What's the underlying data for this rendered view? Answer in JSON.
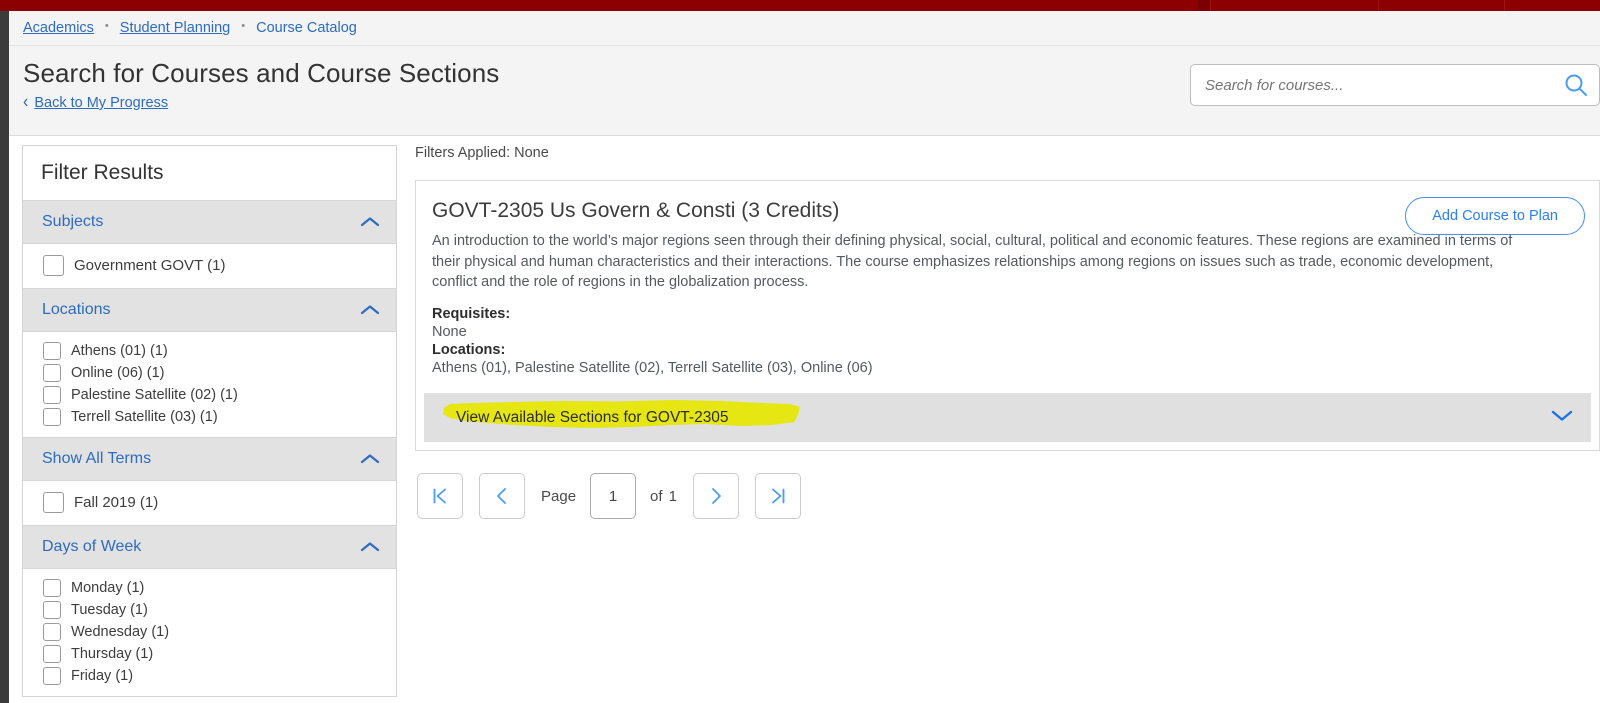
{
  "colors": {
    "brand_red": "#8b0000",
    "link_blue": "#2d6cc0",
    "accent_blue": "#2d7ff0",
    "icon_blue": "#4a9cf0",
    "highlight_yellow": "#e8e800",
    "section_gray": "#e0e0e0",
    "header_gray": "#e2e2e2"
  },
  "breadcrumb": {
    "items": [
      {
        "label": "Academics",
        "current": false
      },
      {
        "label": "Student Planning",
        "current": false
      },
      {
        "label": "Course Catalog",
        "current": true
      }
    ],
    "separator": "•"
  },
  "header": {
    "title": "Search for Courses and Course Sections",
    "back_link": "Back to My Progress",
    "back_chevron_icon": "chevron-left-icon"
  },
  "search": {
    "placeholder": "Search for courses...",
    "value": "",
    "icon": "search-icon"
  },
  "filters": {
    "title": "Filter Results",
    "collapse_icon": "chevron-up-icon",
    "sections": [
      {
        "label": "Subjects",
        "options": [
          {
            "label": "Government GOVT (1)",
            "checked": false
          }
        ]
      },
      {
        "label": "Locations",
        "options": [
          {
            "label": "Athens (01) (1)",
            "checked": false
          },
          {
            "label": "Online (06) (1)",
            "checked": false
          },
          {
            "label": "Palestine Satellite (02) (1)",
            "checked": false
          },
          {
            "label": "Terrell Satellite (03) (1)",
            "checked": false
          }
        ]
      },
      {
        "label": "Show All Terms",
        "options": [
          {
            "label": "Fall 2019 (1)",
            "checked": false
          }
        ]
      },
      {
        "label": "Days of Week",
        "options": [
          {
            "label": "Monday (1)",
            "checked": false
          },
          {
            "label": "Tuesday (1)",
            "checked": false
          },
          {
            "label": "Wednesday (1)",
            "checked": false
          },
          {
            "label": "Thursday (1)",
            "checked": false
          },
          {
            "label": "Friday (1)",
            "checked": false
          }
        ]
      }
    ]
  },
  "results": {
    "filters_applied_label": "Filters Applied:",
    "filters_applied_value": "None",
    "course": {
      "title": "GOVT-2305 Us Govern & Consti (3 Credits)",
      "add_button": "Add Course to Plan",
      "description": "An introduction to the world’s major regions seen through their defining physical, social, cultural, political and economic features. These regions are examined in terms of their physical and human characteristics and their interactions. The course emphasizes relationships among regions on issues such as trade, economic development, conflict and the role of regions in the globalization process.",
      "requisites_label": "Requisites:",
      "requisites_value": "None",
      "locations_label": "Locations:",
      "locations_value": "Athens (01), Palestine Satellite (02), Terrell Satellite (03), Online (06)",
      "sections_link": "View Available Sections for GOVT-2305",
      "sections_expand_icon": "chevron-down-icon",
      "highlighted": true
    }
  },
  "pagination": {
    "first_icon": "first-page-icon",
    "prev_icon": "previous-page-icon",
    "page_label": "Page",
    "page_value": "1",
    "of_label": "of",
    "total_pages": "1",
    "next_icon": "next-page-icon",
    "last_icon": "last-page-icon"
  }
}
